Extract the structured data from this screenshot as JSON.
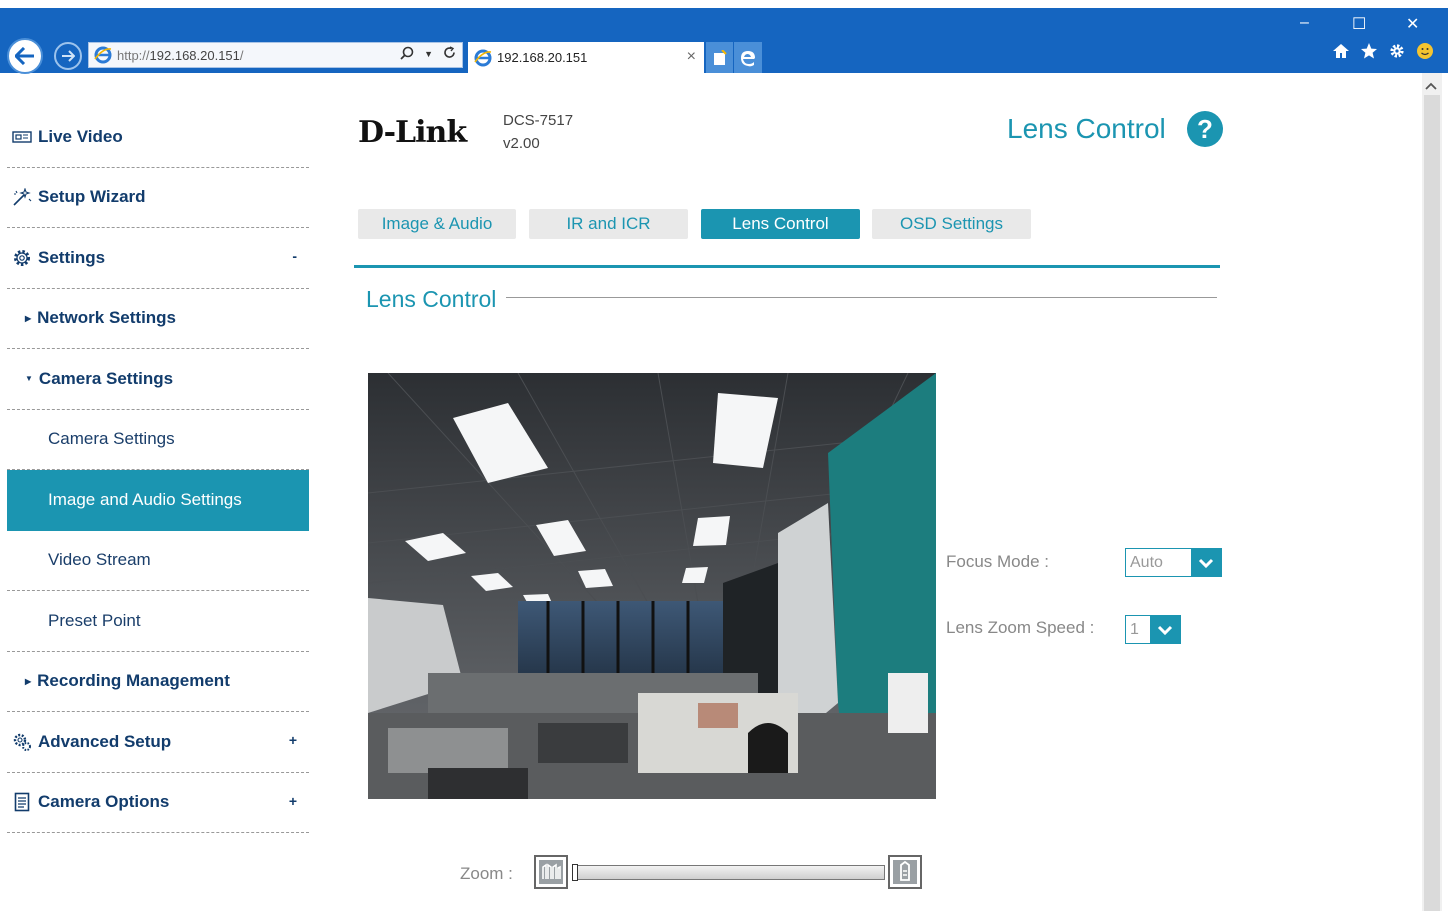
{
  "browser": {
    "url_prefix": "http://",
    "url_host": "192.168.20.151",
    "url_suffix": "/",
    "tab_title": "192.168.20.151",
    "tab_close": "×",
    "window_controls": [
      "–",
      "☐",
      "✕"
    ]
  },
  "sidebar": {
    "items": [
      {
        "label": "Live Video",
        "icon": "live-video-icon"
      },
      {
        "label": "Setup Wizard",
        "icon": "wand-icon"
      },
      {
        "label": "Settings",
        "icon": "gear-icon",
        "toggle": "-"
      },
      {
        "label": "Network Settings",
        "icon": "caret-right-icon"
      },
      {
        "label": "Camera Settings",
        "icon": "caret-down-icon"
      },
      {
        "label": "Camera Settings"
      },
      {
        "label": "Image and Audio Settings",
        "active": true
      },
      {
        "label": "Video Stream"
      },
      {
        "label": "Preset Point"
      },
      {
        "label": "Recording Management",
        "icon": "caret-right-icon"
      },
      {
        "label": "Advanced Setup",
        "icon": "advanced-gear-icon",
        "toggle": "+"
      },
      {
        "label": "Camera Options",
        "icon": "document-icon",
        "toggle": "+"
      }
    ]
  },
  "header": {
    "brand": "D-Link",
    "model": "DCS-7517",
    "version": "v2.00",
    "page_title": "Lens Control",
    "help": "?"
  },
  "tabs": [
    {
      "label": "Image & Audio"
    },
    {
      "label": "IR and ICR"
    },
    {
      "label": "Lens Control",
      "active": true
    },
    {
      "label": "OSD Settings"
    }
  ],
  "section": {
    "title": "Lens Control"
  },
  "controls": {
    "focus_mode_label": "Focus Mode  :",
    "focus_mode_value": "Auto",
    "zoom_speed_label": "Lens Zoom Speed  :",
    "zoom_speed_value": "1",
    "zoom_label": "Zoom :",
    "zoom_level": 0
  },
  "colors": {
    "accent": "#1b95b1",
    "nav_text": "#123c6c",
    "browser_bar": "#1565c0"
  }
}
